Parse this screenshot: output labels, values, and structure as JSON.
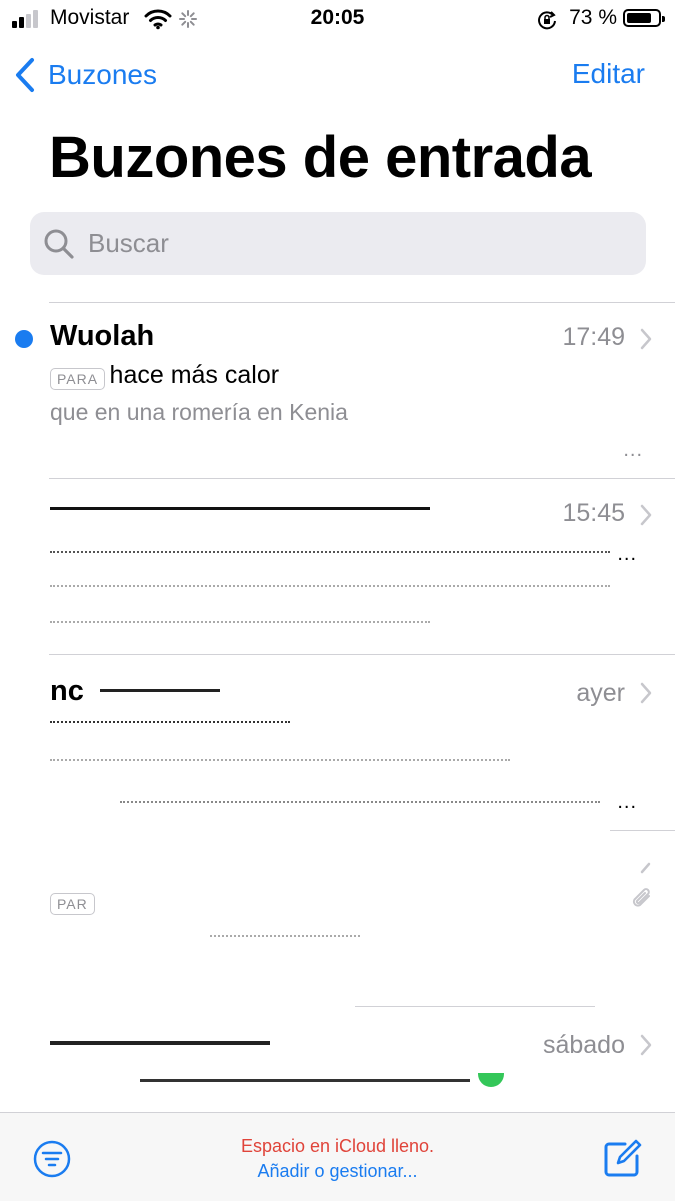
{
  "status_bar": {
    "carrier": "Movistar",
    "time": "20:05",
    "battery": "73 %",
    "battery_level": 0.73
  },
  "nav": {
    "back_label": "Buzones",
    "edit_label": "Editar"
  },
  "page_title": "Buzones de entrada",
  "search": {
    "placeholder": "Buscar"
  },
  "messages": [
    {
      "sender": "Wuolah",
      "time": "17:49",
      "badge": "PARA",
      "subject": "hace más calor",
      "preview": "que en una romería en Kenia",
      "unread": true,
      "more": "..."
    },
    {
      "sender": "",
      "time": "15:45",
      "more": "..."
    },
    {
      "sender": "nc",
      "time": "ayer",
      "more": "..."
    },
    {
      "sender": "",
      "time": "",
      "badge": "PAR",
      "more": ""
    },
    {
      "sender": "",
      "time": "sábado",
      "more": ""
    }
  ],
  "toolbar": {
    "status_line1": "Espacio en iCloud lleno.",
    "status_line2": "Añadir o gestionar..."
  },
  "colors": {
    "accent": "#1a7cf0",
    "warning": "#e0443a",
    "secondary_text": "#8e8e93"
  }
}
